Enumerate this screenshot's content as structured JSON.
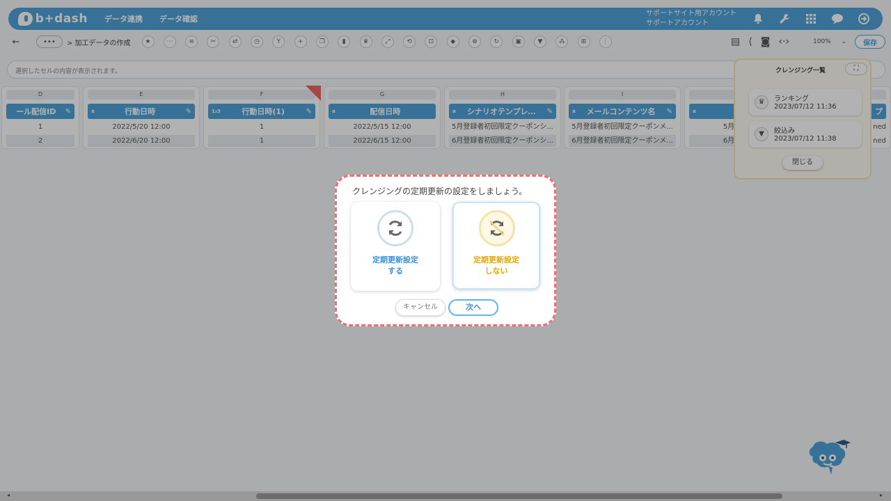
{
  "header": {
    "logo_text": "b+dash",
    "nav": [
      "データ連携",
      "データ確認"
    ],
    "account_line1": "サポートサイト用アカウント",
    "account_line2": "サポートアカウント",
    "icons": [
      "bell-icon",
      "wrench-icon",
      "grid-icon",
      "chat-icon",
      "logout-icon"
    ]
  },
  "toolbar": {
    "more": "•••",
    "breadcrumb": "> 加工データの作成",
    "zoom": "100%",
    "save_label": "保存"
  },
  "cellbar": {
    "placeholder": "選択したセルの内容が表示されます。"
  },
  "columns": [
    {
      "letter": "D",
      "type": "",
      "name": "ール配信ID",
      "cells": [
        "1",
        "2"
      ]
    },
    {
      "letter": "E",
      "type": "a",
      "name": "行動日時",
      "cells": [
        "2022/5/20 12:00",
        "2022/6/20 12:00"
      ]
    },
    {
      "letter": "F",
      "type": "1₂3",
      "name": "行動日時(1)",
      "cells": [
        "1",
        "1"
      ]
    },
    {
      "letter": "G",
      "type": "a",
      "name": "配信日時",
      "cells": [
        "2022/5/15 12:00",
        "2022/6/15 12:00"
      ]
    },
    {
      "letter": "H",
      "type": "a",
      "name": "シナリオテンプレ…",
      "cells": [
        "5月登録者初回限定クーポンシ...",
        "6月登録者初回限定クーポンシ..."
      ]
    },
    {
      "letter": "I",
      "type": "a",
      "name": "メールコンテンツ名",
      "cells": [
        "5月登録者初回限定クーポンメ...",
        "6月登録者初回限定クーポンメ..."
      ]
    },
    {
      "letter": "",
      "type": "a",
      "name": "メー",
      "cells": [
        "5月登録者初",
        "6月登録者初"
      ]
    },
    {
      "letter": "",
      "type": "",
      "name": "プ",
      "cells": [
        "ned",
        "ned"
      ]
    }
  ],
  "cleansing_panel": {
    "title": "クレンジング一覧",
    "items": [
      {
        "name": "ランキング",
        "date": "2023/07/12 11:36",
        "icon": "crown-icon"
      },
      {
        "name": "絞込み",
        "date": "2023/07/12 11:38",
        "icon": "filter-icon"
      }
    ],
    "close_label": "閉じる"
  },
  "dialog": {
    "title": "クレンジングの定期更新の設定をしましょう。",
    "option_yes_line1": "定期更新設定",
    "option_yes_line2": "する",
    "option_no_line1": "定期更新設定",
    "option_no_line2": "しない",
    "cancel_label": "キャンセル",
    "next_label": "次へ"
  },
  "colors": {
    "brand": "#4fa3d8",
    "dialog_border": "#ec6f78",
    "option_yes": "#3a93d6",
    "option_no": "#e8a800"
  }
}
